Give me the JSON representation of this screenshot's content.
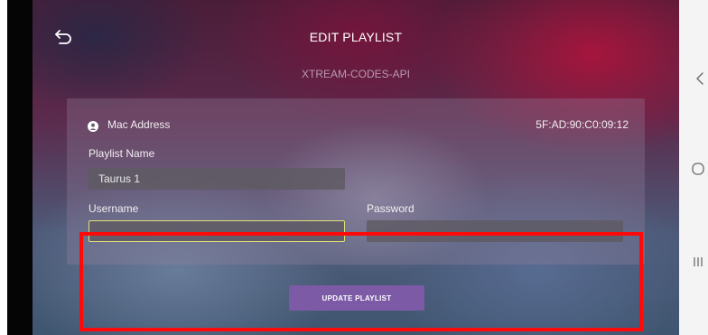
{
  "header": {
    "title": "EDIT PLAYLIST",
    "subtitle": "XTREAM-CODES-API"
  },
  "panel": {
    "mac_label": "Mac Address",
    "mac_value": "5F:AD:90:C0:09:12",
    "playlist_name_label": "Playlist Name",
    "playlist_name_value": "Taurus 1",
    "username_label": "Username",
    "username_value": "",
    "password_label": "Password",
    "password_value": ""
  },
  "actions": {
    "update_label": "UPDATE PLAYLIST"
  },
  "icons": {
    "back": "back-arrow-icon",
    "user": "user-circle-icon",
    "nav_back": "chevron-left-icon",
    "nav_home": "circle-home-icon",
    "nav_recent": "recent-apps-icon"
  },
  "colors": {
    "accent_button": "#7c5aa6",
    "focus_border": "#e2e07a",
    "highlight_box": "#ff0a0a"
  }
}
